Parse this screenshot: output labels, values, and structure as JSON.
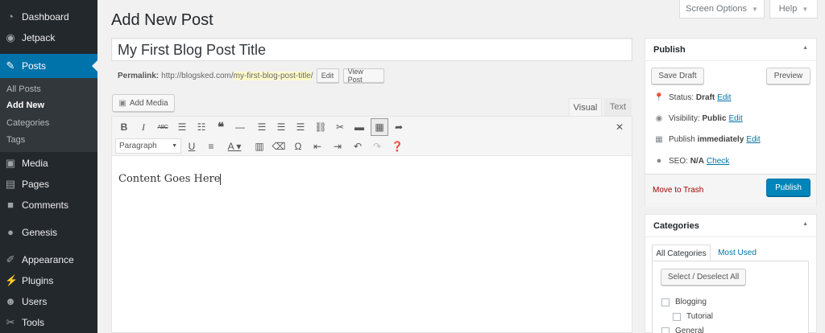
{
  "colors": {
    "sidebar": "#23282d",
    "accent": "#0073aa",
    "publish": "#0085ba",
    "trash": "#a00"
  },
  "sidebar": {
    "items": [
      {
        "label": "Dashboard",
        "icon": "dashboard-icon"
      },
      {
        "label": "Jetpack",
        "icon": "jetpack-icon"
      },
      {
        "label": "Posts",
        "icon": "pin-icon",
        "current": true
      },
      {
        "label": "Media",
        "icon": "media-icon"
      },
      {
        "label": "Pages",
        "icon": "pages-icon"
      },
      {
        "label": "Comments",
        "icon": "comments-icon"
      },
      {
        "label": "Genesis",
        "icon": "genesis-icon"
      },
      {
        "label": "Appearance",
        "icon": "brush-icon"
      },
      {
        "label": "Plugins",
        "icon": "plug-icon"
      },
      {
        "label": "Users",
        "icon": "user-icon"
      },
      {
        "label": "Tools",
        "icon": "wrench-icon"
      }
    ],
    "submenu": [
      "All Posts",
      "Add New",
      "Categories",
      "Tags"
    ]
  },
  "screen_meta": {
    "screen_options": "Screen Options",
    "help": "Help"
  },
  "page_title": "Add New Post",
  "post": {
    "title": "My First Blog Post Title",
    "permalink_label": "Permalink:",
    "permalink_base": "http://blogsked.com/",
    "permalink_slug": "my-first-blog-post-title",
    "permalink_trail": "/",
    "edit_btn": "Edit",
    "view_btn": "View Post"
  },
  "editor": {
    "add_media": "Add Media",
    "tab_visual": "Visual",
    "tab_text": "Text",
    "format_selected": "Paragraph",
    "content": "Content Goes Here",
    "row1": [
      "bold-icon",
      "italic-icon",
      "strikethrough-icon",
      "bullet-list-icon",
      "numbered-list-icon",
      "blockquote-icon",
      "horizontal-line-icon",
      "align-left-icon",
      "align-center-icon",
      "align-right-icon",
      "link-icon",
      "unlink-icon",
      "read-more-icon",
      "toolbar-toggle-icon",
      "distraction-free-icon",
      "fullscreen-icon"
    ],
    "row2": [
      "underline-icon",
      "justify-icon",
      "text-color-icon",
      "paste-text-icon",
      "clear-format-icon",
      "special-char-icon",
      "outdent-icon",
      "indent-icon",
      "undo-icon",
      "redo-icon",
      "help-icon"
    ]
  },
  "publish_box": {
    "title": "Publish",
    "save_draft": "Save Draft",
    "preview": "Preview",
    "status_label": "Status:",
    "status_value": "Draft",
    "visibility_label": "Visibility:",
    "visibility_value": "Public",
    "publish_label": "Publish",
    "publish_value": "immediately",
    "seo_label": "SEO:",
    "seo_value": "N/A",
    "edit_link": "Edit",
    "check_link": "Check",
    "trash": "Move to Trash",
    "publish_btn": "Publish"
  },
  "categories_box": {
    "title": "Categories",
    "tab_all": "All Categories",
    "tab_used": "Most Used",
    "select_all": "Select / Deselect All",
    "items": [
      "Blogging",
      "Tutorial",
      "General"
    ]
  }
}
